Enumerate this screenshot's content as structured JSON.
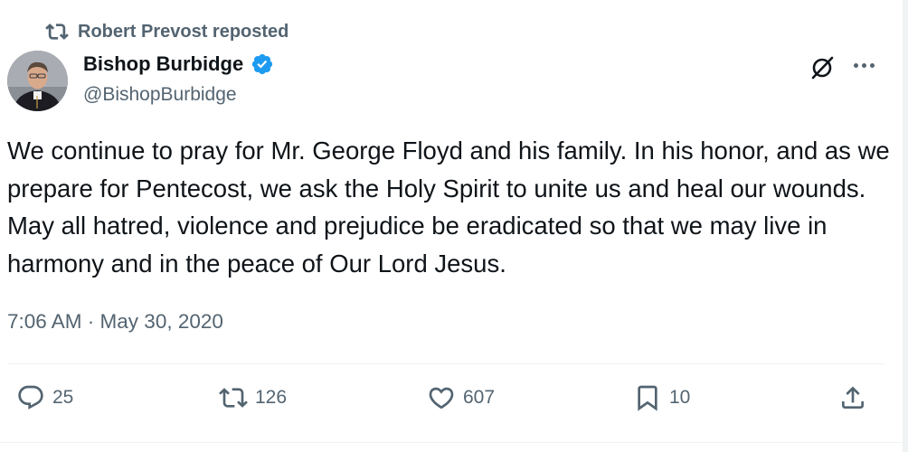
{
  "repost": {
    "icon": "repost-icon",
    "text": "Robert Prevost reposted"
  },
  "author": {
    "display_name": "Bishop Burbidge",
    "handle": "@BishopBurbidge",
    "verified": true,
    "avatar": "avatar-photo"
  },
  "tweet": {
    "text": "We continue to pray for Mr. George Floyd and his family. In his honor, and as we prepare for Pentecost, we ask the Holy Spirit to unite us and heal our wounds. May all hatred, violence and prejudice be eradicated so that we may live in harmony and in the peace of Our Lord Jesus.",
    "timestamp": "7:06 AM · May 30, 2020"
  },
  "actions": {
    "replies": "25",
    "reposts": "126",
    "likes": "607",
    "bookmarks": "10"
  },
  "colors": {
    "text": "#0f1419",
    "secondary": "#536471",
    "verified": "#1d9bf0",
    "divider": "#eff3f4"
  }
}
